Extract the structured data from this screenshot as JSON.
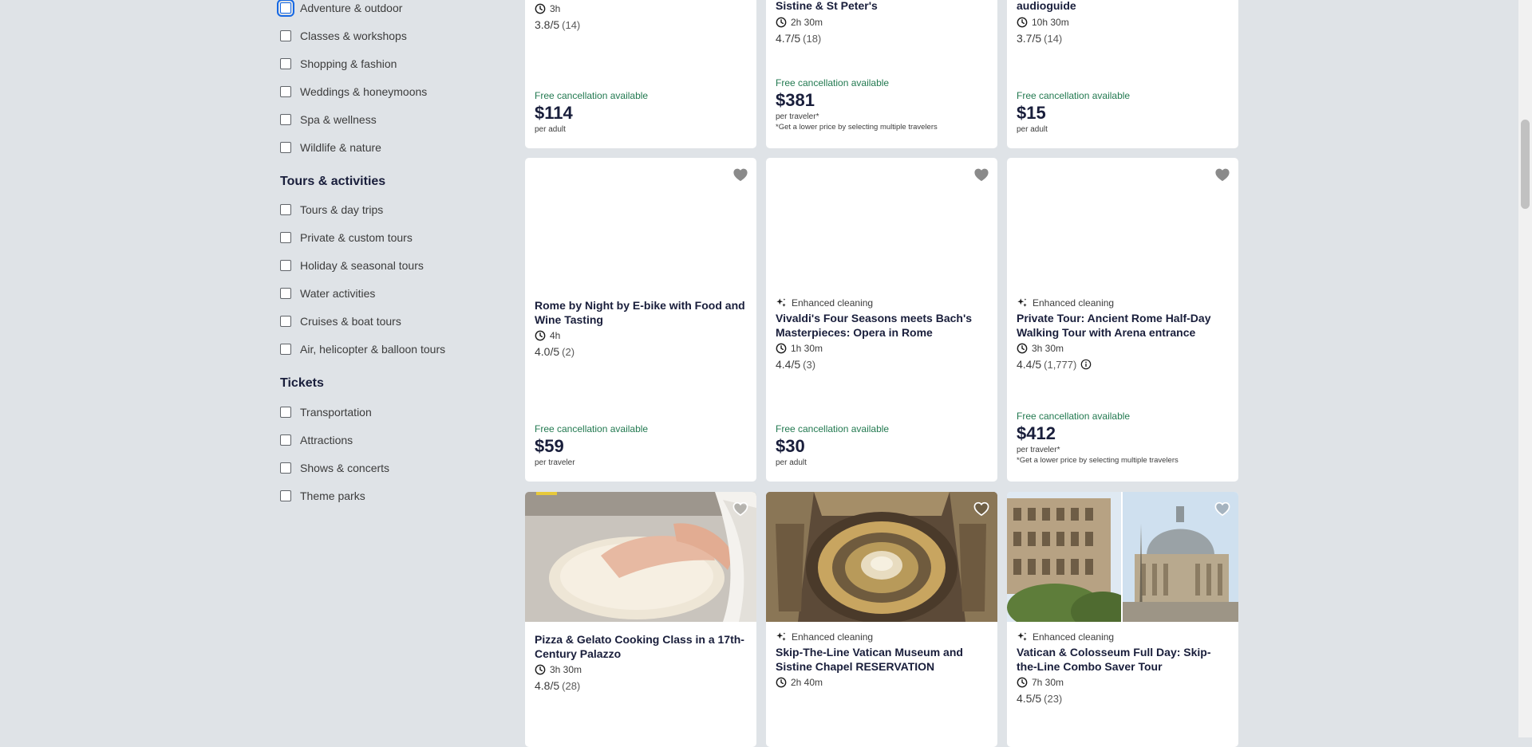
{
  "sidebar": {
    "group_top": [
      {
        "label": "Adventure & outdoor"
      },
      {
        "label": "Classes & workshops"
      },
      {
        "label": "Shopping & fashion"
      },
      {
        "label": "Weddings & honeymoons"
      },
      {
        "label": "Spa & wellness"
      },
      {
        "label": "Wildlife & nature"
      }
    ],
    "tours_title": "Tours & activities",
    "tours": [
      {
        "label": "Tours & day trips"
      },
      {
        "label": "Private & custom tours"
      },
      {
        "label": "Holiday & seasonal tours"
      },
      {
        "label": "Water activities"
      },
      {
        "label": "Cruises & boat tours"
      },
      {
        "label": "Air, helicopter & balloon tours"
      }
    ],
    "tickets_title": "Tickets",
    "tickets": [
      {
        "label": "Transportation"
      },
      {
        "label": "Attractions"
      },
      {
        "label": "Shows & concerts"
      },
      {
        "label": "Theme parks"
      }
    ]
  },
  "cards": {
    "r1c1": {
      "duration": "3h",
      "rating": "3.8/5",
      "rating_count": "(14)",
      "free_cancel": "Free cancellation available",
      "price": "$114",
      "unit": "per adult"
    },
    "r1c2": {
      "title": "Sistine & St Peter's",
      "duration": "2h 30m",
      "rating": "4.7/5",
      "rating_count": "(18)",
      "free_cancel": "Free cancellation available",
      "price": "$381",
      "unit": "per traveler*",
      "note": "*Get a lower price by selecting multiple travelers"
    },
    "r1c3": {
      "title": "audioguide",
      "duration": "10h 30m",
      "rating": "3.7/5",
      "rating_count": "(14)",
      "free_cancel": "Free cancellation available",
      "price": "$15",
      "unit": "per adult"
    },
    "r2c1": {
      "title": "Rome by Night by E-bike with Food and Wine Tasting",
      "duration": "4h",
      "rating": "4.0/5",
      "rating_count": "(2)",
      "free_cancel": "Free cancellation available",
      "price": "$59",
      "unit": "per traveler"
    },
    "r2c2": {
      "enhanced": "Enhanced cleaning",
      "title": "Vivaldi's Four Seasons meets Bach's Masterpieces: Opera in Rome",
      "duration": "1h 30m",
      "rating": "4.4/5",
      "rating_count": "(3)",
      "free_cancel": "Free cancellation available",
      "price": "$30",
      "unit": "per adult"
    },
    "r2c3": {
      "enhanced": "Enhanced cleaning",
      "title": "Private Tour: Ancient Rome Half-Day Walking Tour with Arena entrance",
      "duration": "3h 30m",
      "rating": "4.4/5",
      "rating_count": "(1,777)",
      "free_cancel": "Free cancellation available",
      "price": "$412",
      "unit": "per traveler*",
      "note": "*Get a lower price by selecting multiple travelers"
    },
    "r3c1": {
      "title": "Pizza & Gelato Cooking Class in a 17th-Century Palazzo",
      "duration": "3h 30m",
      "rating": "4.8/5",
      "rating_count": "(28)"
    },
    "r3c2": {
      "enhanced": "Enhanced cleaning",
      "title": "Skip-The-Line Vatican Museum and Sistine Chapel RESERVATION",
      "duration": "2h 40m"
    },
    "r3c3": {
      "enhanced": "Enhanced cleaning",
      "title": "Vatican & Colosseum Full Day: Skip-the-Line Combo Saver Tour",
      "duration": "7h 30m",
      "rating": "4.5/5",
      "rating_count": "(23)"
    }
  },
  "colors": {
    "free_cancel": "#227950",
    "title": "#191e3b",
    "background": "#dfe3e7",
    "focus": "#1668e3"
  }
}
